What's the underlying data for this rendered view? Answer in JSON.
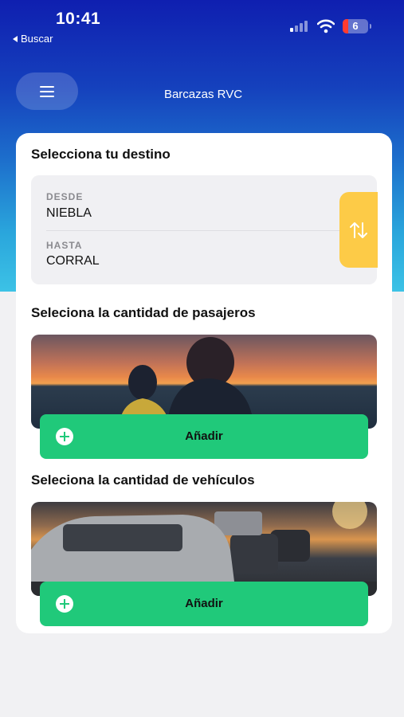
{
  "status_bar": {
    "time": "10:41",
    "back_label": "Buscar",
    "battery_level": "6"
  },
  "header": {
    "title": "Barcazas RVC",
    "menu_icon": "hamburger-icon"
  },
  "destination": {
    "title": "Selecciona tu destino",
    "from_label": "DESDE",
    "from_value": "NIEBLA",
    "to_label": "HASTA",
    "to_value": "CORRAL",
    "swap_icon": "swap-arrows-icon"
  },
  "passengers": {
    "title": "Seleciona la cantidad de pasajeros",
    "add_label": "Añadir"
  },
  "vehicles": {
    "title": "Seleciona la cantidad de vehículos",
    "add_label": "Añadir"
  },
  "colors": {
    "accent_green": "#20c97a",
    "swap_yellow": "#fdcb47",
    "header_blue": "#0f1fb0"
  }
}
